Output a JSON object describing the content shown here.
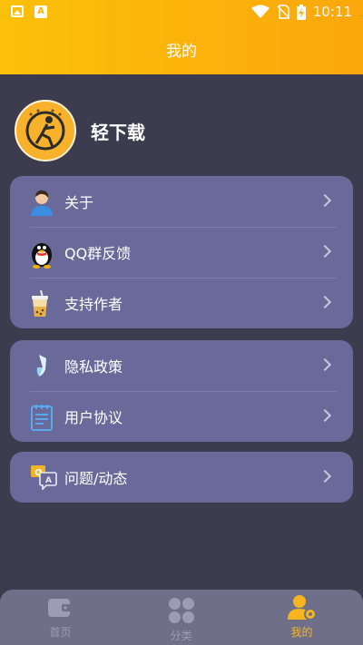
{
  "status": {
    "time": "10:11"
  },
  "header": {
    "title": "我的"
  },
  "profile": {
    "name": "轻下载"
  },
  "menu_group_1": [
    {
      "label": "关于",
      "icon": "person-icon"
    },
    {
      "label": "QQ群反馈",
      "icon": "qq-penguin-icon"
    },
    {
      "label": "支持作者",
      "icon": "drink-cup-icon"
    }
  ],
  "menu_group_2": [
    {
      "label": "隐私政策",
      "icon": "shield-icon"
    },
    {
      "label": "用户协议",
      "icon": "document-icon"
    }
  ],
  "menu_group_3": [
    {
      "label": "问题/动态",
      "icon": "qa-chat-icon"
    }
  ],
  "bottom_nav": {
    "tabs": [
      {
        "label": "首页",
        "icon": "wallet-icon",
        "active": false
      },
      {
        "label": "分类",
        "icon": "grid-icon",
        "active": false
      },
      {
        "label": "我的",
        "icon": "user-icon",
        "active": true
      }
    ]
  },
  "colors": {
    "header_gradient_start": "#fcc00a",
    "header_gradient_end": "#fba70c",
    "background": "#3d3c4e",
    "card": "#6a6a9a",
    "active_tab": "#f6b51e"
  }
}
